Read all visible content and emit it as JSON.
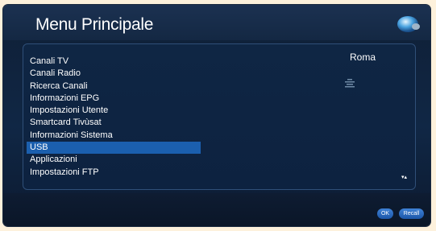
{
  "header": {
    "title": "Menu Principale"
  },
  "menu": {
    "items": [
      "Canali TV",
      "Canali Radio",
      "Ricerca Canali",
      "Informazioni EPG",
      "Impostazioni Utente",
      "Smartcard Tivùsat",
      "Informazioni Sistema",
      "USB",
      "Applicazioni",
      "Impostazioni FTP"
    ],
    "selected_index": 7
  },
  "info": {
    "city": "Roma",
    "weather_icon": "weather-lines-icon"
  },
  "scroll": {
    "arrows": "▾▴"
  },
  "footer": {
    "ok_label": "OK",
    "recall_label": "Recall"
  },
  "colors": {
    "selection": "#1b5fae",
    "button": "#2a6dc4",
    "background": "#0f2644"
  }
}
